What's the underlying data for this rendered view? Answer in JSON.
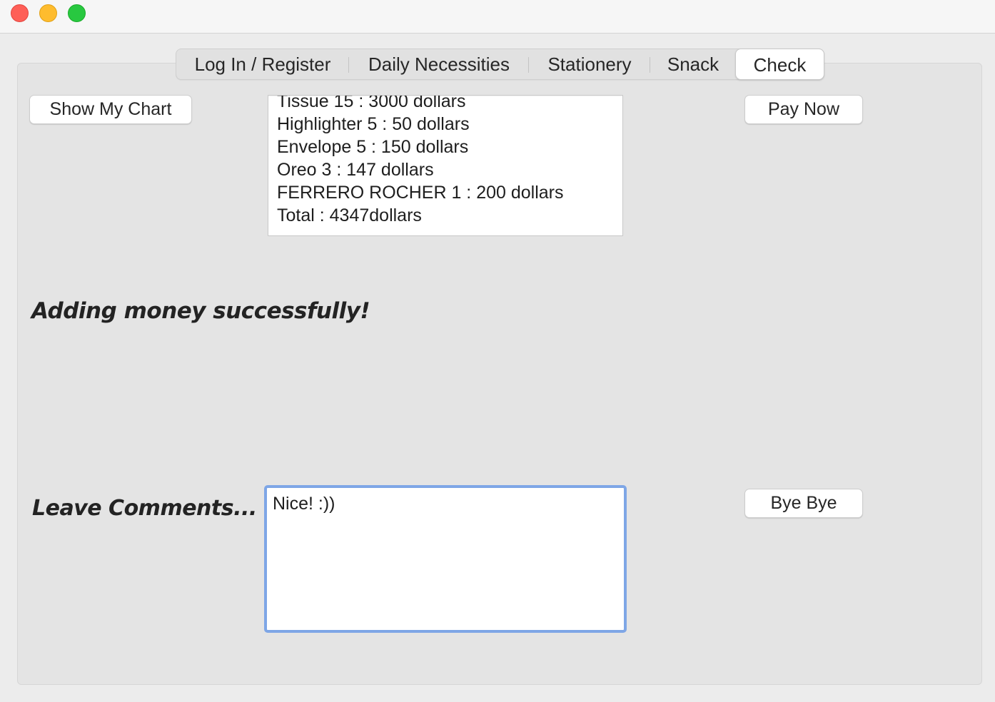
{
  "window": {
    "controls": [
      "close",
      "minimize",
      "zoom"
    ]
  },
  "tabs": [
    {
      "label": "Log In / Register"
    },
    {
      "label": "Daily Necessities"
    },
    {
      "label": "Stationery"
    },
    {
      "label": "Snack"
    },
    {
      "label": "Check",
      "selected": true
    }
  ],
  "check": {
    "show_chart_label": "Show My Chart",
    "pay_now_label": "Pay Now",
    "bye_label": "Bye Bye",
    "cart_lines": [
      "Tissue 15 : 3000 dollars",
      "Highlighter 5 : 50 dollars",
      "Envelope 5 : 150 dollars",
      "Oreo 3 : 147 dollars",
      "FERRERO ROCHER 1 : 200 dollars",
      "Total : 4347dollars"
    ],
    "status_message": "Adding money successfully!",
    "comments_label": "Leave Comments...",
    "comment_value": "Nice! :))"
  },
  "colors": {
    "focus_ring": "#7ea6e6",
    "close": "#fe5f57",
    "minimize": "#febc2e",
    "zoom": "#28c840"
  }
}
